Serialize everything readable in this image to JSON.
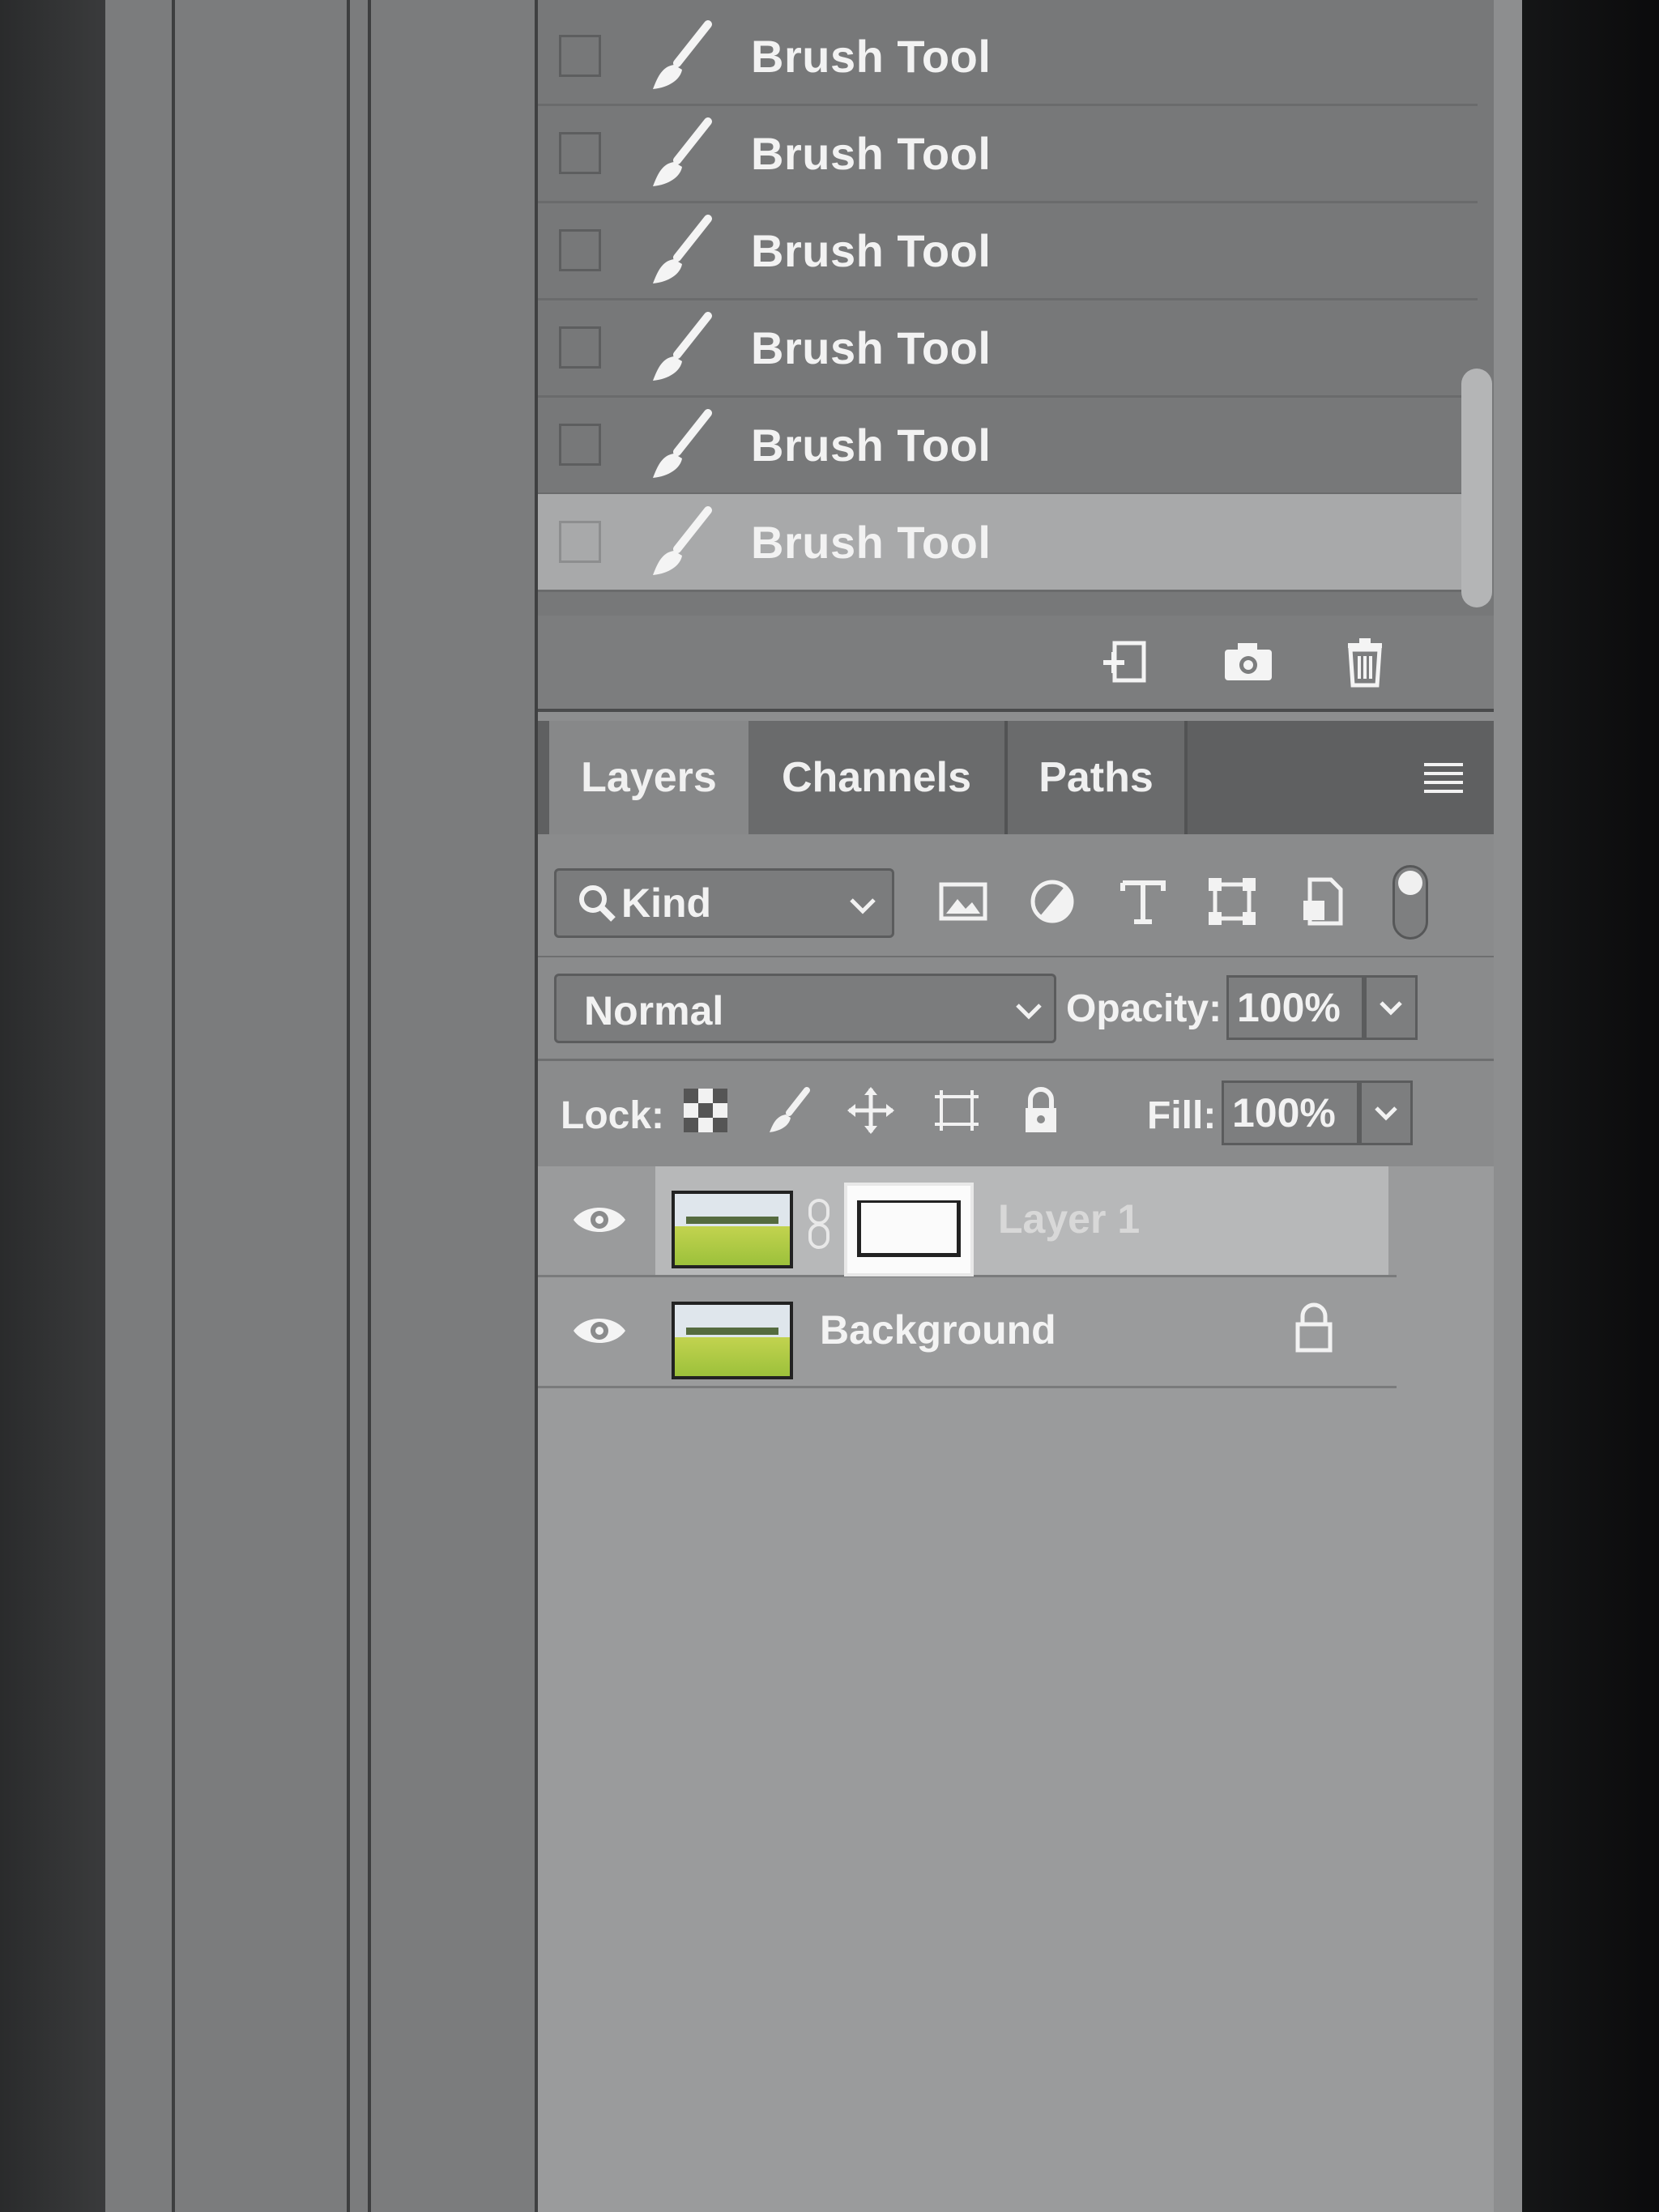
{
  "history": {
    "items": [
      {
        "label": "Brush Tool",
        "active": false
      },
      {
        "label": "Brush Tool",
        "active": false
      },
      {
        "label": "Brush Tool",
        "active": false
      },
      {
        "label": "Brush Tool",
        "active": false
      },
      {
        "label": "Brush Tool",
        "active": false
      },
      {
        "label": "Brush Tool",
        "active": true
      }
    ],
    "footer_icons": [
      "new-document-from-state-icon",
      "camera-icon",
      "trash-icon"
    ]
  },
  "tabs": [
    {
      "label": "Layers",
      "active": true
    },
    {
      "label": "Channels",
      "active": false
    },
    {
      "label": "Paths",
      "active": false
    }
  ],
  "filter": {
    "kind_label": "Kind",
    "icons": [
      "pixel-layer-filter-icon",
      "adjustment-layer-filter-icon",
      "type-layer-filter-icon",
      "shape-layer-filter-icon",
      "smart-object-filter-icon"
    ]
  },
  "blend": {
    "mode": "Normal",
    "opacity_label": "Opacity:",
    "opacity_value": "100%"
  },
  "lock": {
    "label": "Lock:",
    "icons": [
      "lock-transparent-pixels-icon",
      "lock-image-pixels-icon",
      "lock-position-icon",
      "lock-artboard-icon",
      "lock-all-icon"
    ],
    "fill_label": "Fill:",
    "fill_value": "100%"
  },
  "layers": [
    {
      "name": "Layer 1",
      "visible": true,
      "selected": true,
      "has_mask": true
    },
    {
      "name": "Background",
      "visible": true,
      "selected": false,
      "locked": true
    }
  ]
}
